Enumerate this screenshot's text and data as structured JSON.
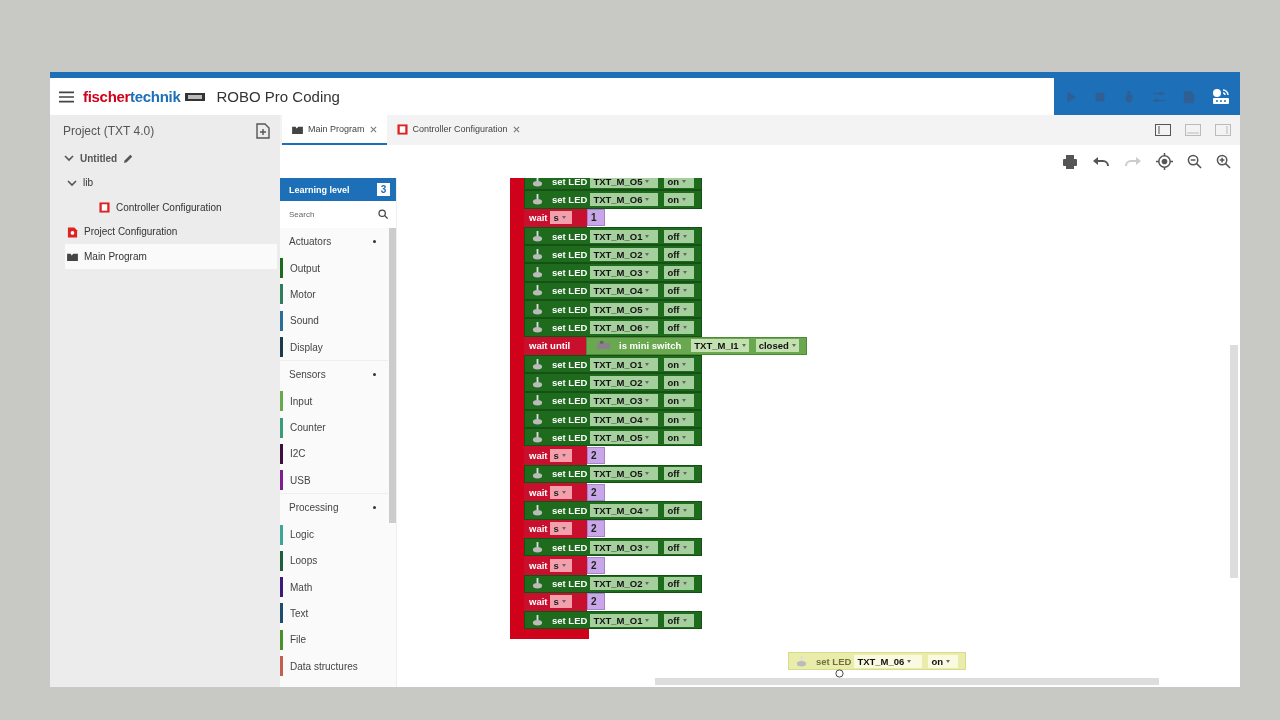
{
  "header": {
    "logo_parts": [
      "fischer",
      "technik"
    ],
    "app_title": "ROBO Pro Coding",
    "tools": [
      {
        "kind": "play",
        "disabled": true
      },
      {
        "kind": "stop",
        "disabled": true
      },
      {
        "kind": "debug",
        "disabled": true
      },
      {
        "kind": "sliders",
        "disabled": true
      },
      {
        "kind": "file",
        "disabled": true
      },
      {
        "kind": "router",
        "disabled": false
      }
    ]
  },
  "project": {
    "title": "Project (TXT 4.0)",
    "tree": [
      {
        "label": "Untitled",
        "kind": "project",
        "expanded": true,
        "selected": false,
        "children": [
          {
            "label": "lib",
            "kind": "folder",
            "expanded": true,
            "selected": false,
            "children": [
              {
                "label": "Controller Configuration",
                "kind": "controller",
                "selected": false
              }
            ]
          },
          {
            "label": "Project Configuration",
            "kind": "config",
            "selected": false
          },
          {
            "label": "Main Program",
            "kind": "program",
            "selected": true
          }
        ]
      }
    ]
  },
  "tabs": [
    {
      "label": "Main Program",
      "kind": "program",
      "selected": true
    },
    {
      "label": "Controller Configuration",
      "kind": "controller",
      "selected": false
    }
  ],
  "view_toggles": [
    {
      "kind": "left",
      "selected": true
    },
    {
      "kind": "bottom",
      "selected": false
    },
    {
      "kind": "right",
      "selected": false
    }
  ],
  "canvas_toolbar": [
    {
      "kind": "print",
      "disabled": false
    },
    {
      "kind": "undo",
      "disabled": false
    },
    {
      "kind": "redo",
      "disabled": true
    },
    {
      "kind": "center",
      "disabled": false
    },
    {
      "kind": "zoom_out",
      "disabled": false
    },
    {
      "kind": "zoom_in",
      "disabled": false
    }
  ],
  "palette": {
    "title": "Learning level",
    "level_badge": "3",
    "search": {
      "placeholder": "Search"
    },
    "groups": [
      {
        "label": "Actuators",
        "items": [
          {
            "label": "Output",
            "color": "#1e6b1e"
          },
          {
            "label": "Motor",
            "color": "#2e7d5b"
          },
          {
            "label": "Sound",
            "color": "#2a6f97"
          },
          {
            "label": "Display",
            "color": "#1b3a4b"
          }
        ]
      },
      {
        "label": "Sensors",
        "items": [
          {
            "label": "Input",
            "color": "#6aa84f"
          },
          {
            "label": "Counter",
            "color": "#3a9d7a"
          },
          {
            "label": "I2C",
            "color": "#3b1040"
          },
          {
            "label": "USB",
            "color": "#7b1f8a"
          }
        ]
      },
      {
        "label": "Processing",
        "items": [
          {
            "label": "Logic",
            "color": "#3aa79a"
          },
          {
            "label": "Loops",
            "color": "#1f5e3a"
          },
          {
            "label": "Math",
            "color": "#3d1a78"
          },
          {
            "label": "Text",
            "color": "#1d4e6e"
          },
          {
            "label": "File",
            "color": "#4b8f2f"
          },
          {
            "label": "Data structures",
            "color": "#c06050"
          }
        ]
      }
    ]
  },
  "program": [
    {
      "kind": "set_led",
      "label": "set LED",
      "port": "TXT_M_O5",
      "state": "on"
    },
    {
      "kind": "set_led",
      "label": "set LED",
      "port": "TXT_M_O6",
      "state": "on"
    },
    {
      "kind": "wait",
      "label": "wait",
      "unit": "s",
      "value": "1"
    },
    {
      "kind": "set_led",
      "label": "set LED",
      "port": "TXT_M_O1",
      "state": "off"
    },
    {
      "kind": "set_led",
      "label": "set LED",
      "port": "TXT_M_O2",
      "state": "off"
    },
    {
      "kind": "set_led",
      "label": "set LED",
      "port": "TXT_M_O3",
      "state": "off"
    },
    {
      "kind": "set_led",
      "label": "set LED",
      "port": "TXT_M_O4",
      "state": "off"
    },
    {
      "kind": "set_led",
      "label": "set LED",
      "port": "TXT_M_O5",
      "state": "off"
    },
    {
      "kind": "set_led",
      "label": "set LED",
      "port": "TXT_M_O6",
      "state": "off"
    },
    {
      "kind": "wait_until",
      "label": "wait until",
      "sensor": "is mini switch",
      "port": "TXT_M_I1",
      "state": "closed"
    },
    {
      "kind": "set_led",
      "label": "set LED",
      "port": "TXT_M_O1",
      "state": "on"
    },
    {
      "kind": "set_led",
      "label": "set LED",
      "port": "TXT_M_O2",
      "state": "on"
    },
    {
      "kind": "set_led",
      "label": "set LED",
      "port": "TXT_M_O3",
      "state": "on"
    },
    {
      "kind": "set_led",
      "label": "set LED",
      "port": "TXT_M_O4",
      "state": "on"
    },
    {
      "kind": "set_led",
      "label": "set LED",
      "port": "TXT_M_O5",
      "state": "on"
    },
    {
      "kind": "wait",
      "label": "wait",
      "unit": "s",
      "value": "2"
    },
    {
      "kind": "set_led",
      "label": "set LED",
      "port": "TXT_M_O5",
      "state": "off"
    },
    {
      "kind": "wait",
      "label": "wait",
      "unit": "s",
      "value": "2"
    },
    {
      "kind": "set_led",
      "label": "set LED",
      "port": "TXT_M_O4",
      "state": "off"
    },
    {
      "kind": "wait",
      "label": "wait",
      "unit": "s",
      "value": "2"
    },
    {
      "kind": "set_led",
      "label": "set LED",
      "port": "TXT_M_O3",
      "state": "off"
    },
    {
      "kind": "wait",
      "label": "wait",
      "unit": "s",
      "value": "2"
    },
    {
      "kind": "set_led",
      "label": "set LED",
      "port": "TXT_M_O2",
      "state": "off"
    },
    {
      "kind": "wait",
      "label": "wait",
      "unit": "s",
      "value": "2"
    },
    {
      "kind": "set_led",
      "label": "set LED",
      "port": "TXT_M_O1",
      "state": "off"
    }
  ],
  "dragged_block": {
    "kind": "set_led",
    "label": "set LED",
    "port": "TXT_M_06",
    "state": "on"
  }
}
